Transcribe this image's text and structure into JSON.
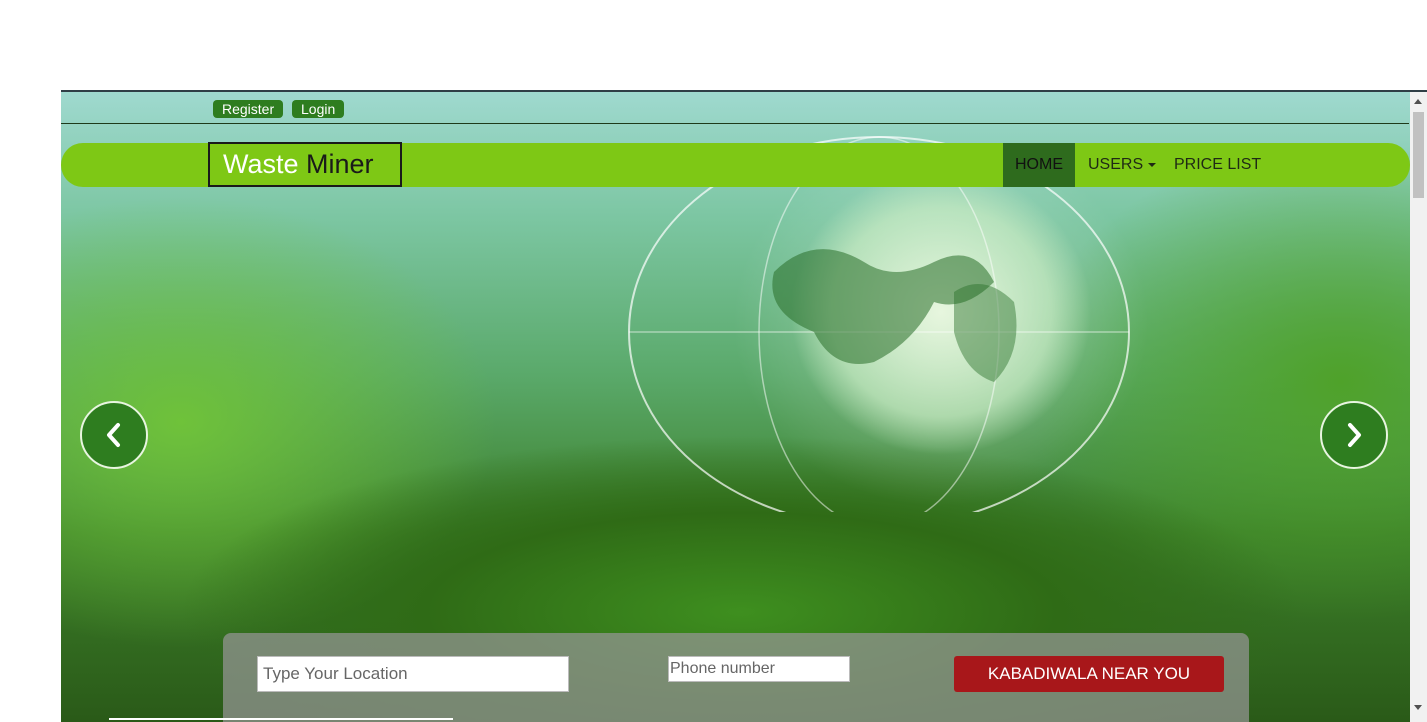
{
  "top_bar": {
    "register_label": "Register",
    "login_label": "Login"
  },
  "navbar": {
    "brand_part1": "Waste",
    "brand_part2": "Miner",
    "items": [
      {
        "label": "HOME",
        "active": true
      },
      {
        "label": "USERS",
        "dropdown": true
      },
      {
        "label": "PRICE LIST"
      }
    ]
  },
  "carousel": {
    "prev_icon": "chevron-left-icon",
    "next_icon": "chevron-right-icon"
  },
  "search": {
    "location_placeholder": "Type Your Location",
    "phone_placeholder": "Phone number",
    "button_label": "KABADIWALA NEAR YOU"
  },
  "colors": {
    "navbar": "#7ec815",
    "active_nav": "#2e6b1d",
    "accent_green": "#2e7d1f",
    "button_red": "#a8171a"
  }
}
